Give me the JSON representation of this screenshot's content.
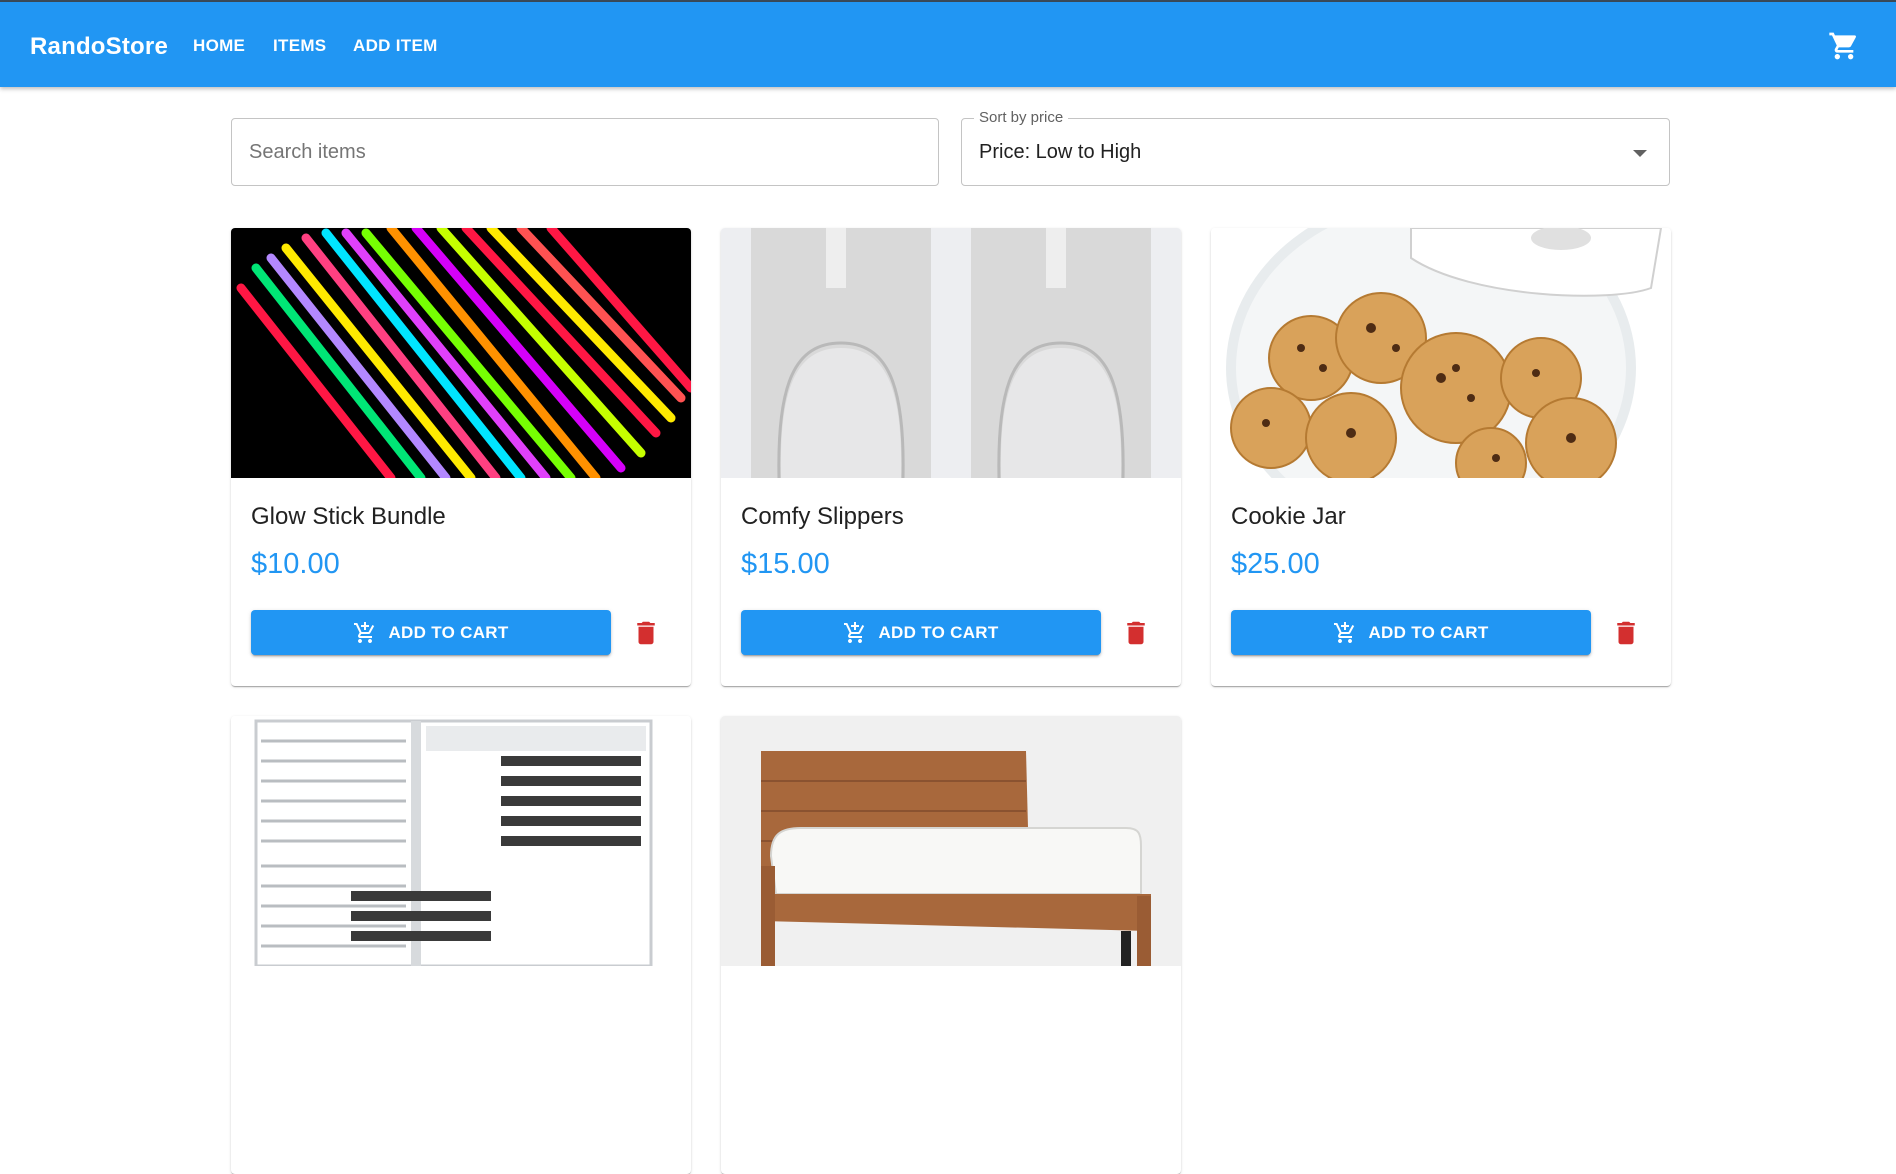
{
  "app": {
    "brand": "RandoStore"
  },
  "nav": {
    "home": "HOME",
    "items": "ITEMS",
    "add_item": "ADD ITEM"
  },
  "icons": {
    "cart": "shopping-cart-icon",
    "add_to_cart": "add-shopping-cart-icon",
    "delete": "trash-icon"
  },
  "colors": {
    "primary": "#2196f3",
    "delete": "#d32f2f"
  },
  "search": {
    "placeholder": "Search items",
    "value": ""
  },
  "sort": {
    "label": "Sort by price",
    "value": "Price: Low to High"
  },
  "buttons": {
    "add_to_cart": "ADD TO CART"
  },
  "items": [
    {
      "name": "Glow Stick Bundle",
      "price": "$10.00"
    },
    {
      "name": "Comfy Slippers",
      "price": "$15.00"
    },
    {
      "name": "Cookie Jar",
      "price": "$25.00"
    },
    {
      "name": "",
      "price": ""
    },
    {
      "name": "",
      "price": ""
    }
  ]
}
